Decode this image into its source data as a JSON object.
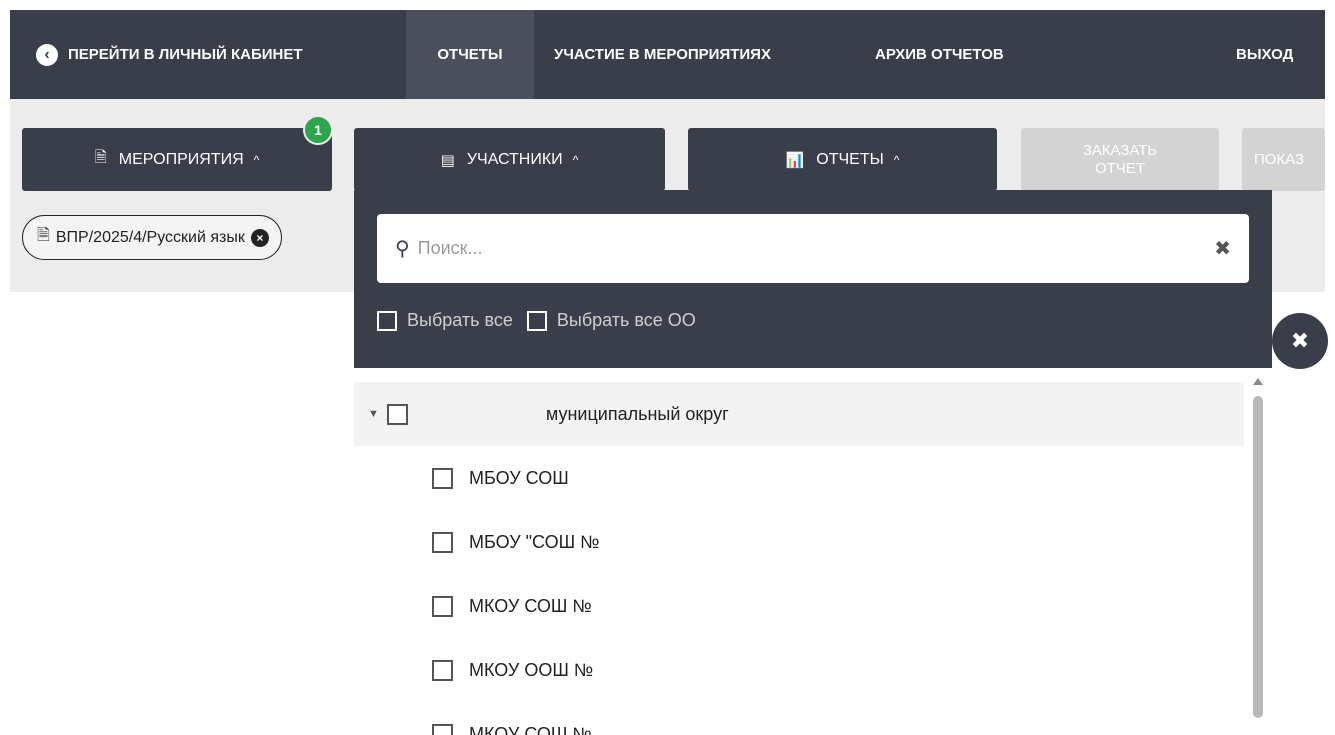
{
  "nav": {
    "back_label": "ПЕРЕЙТИ В ЛИЧНЫЙ КАБИНЕТ",
    "reports_label": "ОТЧЕТЫ",
    "participation_label": "УЧАСТИЕ В МЕРОПРИЯТИЯХ",
    "archive_label": "АРХИВ ОТЧЕТОВ",
    "exit_label": "ВЫХОД"
  },
  "toolbar": {
    "events_label": "МЕРОПРИЯТИЯ",
    "events_badge": "1",
    "participants_label": "УЧАСТНИКИ",
    "reports_label": "ОТЧЕТЫ",
    "order_line1": "ЗАКАЗАТЬ",
    "order_line2": "ОТЧЕТ",
    "show_label": "ПОКАЗ"
  },
  "filter_chip": {
    "label": "ВПР/2025/4/Русский язык"
  },
  "dropdown": {
    "search_placeholder": "Поиск...",
    "select_all_label": "Выбрать все",
    "select_all_oo_label": "Выбрать все ОО",
    "parent": {
      "label": "муниципальный округ"
    },
    "children": [
      {
        "label": "МБОУ СОШ"
      },
      {
        "label": "МБОУ \"СОШ №"
      },
      {
        "label": "МКОУ СОШ №"
      },
      {
        "label": "МКОУ ООШ №"
      },
      {
        "label": "МКОУ СОШ №"
      }
    ]
  },
  "colors": {
    "dark": "#3a3d4a",
    "badge": "#2ea44f",
    "toolbar_bg": "#ececec",
    "disabled": "#d3d3d3"
  }
}
